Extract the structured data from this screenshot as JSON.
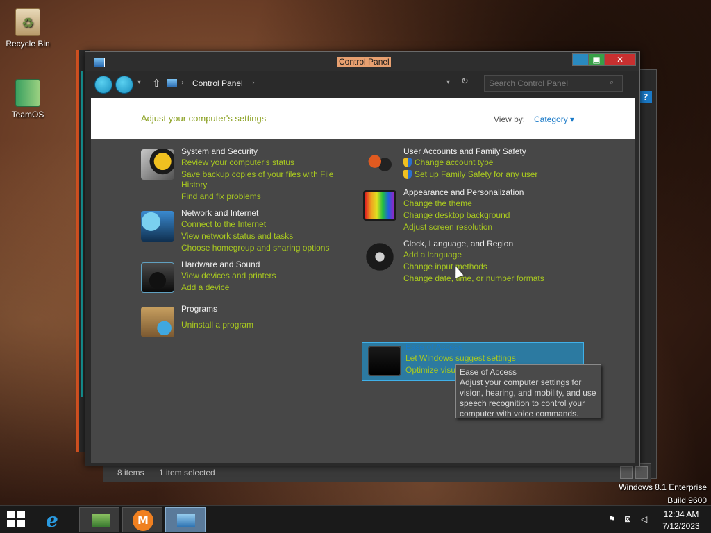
{
  "desktop": {
    "icons": [
      {
        "label": "Recycle Bin"
      },
      {
        "label": "TeamOS"
      }
    ],
    "os_watermark": {
      "line1": "Windows 8.1 Enterprise",
      "line2": "Build 9600"
    }
  },
  "window": {
    "title": "Control Panel",
    "buttons": {
      "minimize": "—",
      "maximize": "▣",
      "close": "✕"
    },
    "breadcrumb": {
      "label": "Control Panel"
    },
    "search": {
      "placeholder": "Search Control Panel"
    },
    "header": {
      "title": "Adjust your computer's settings",
      "view_by_label": "View by:",
      "view_by_value": "Category ▾"
    },
    "categories": [
      {
        "title": "System and Security",
        "icon": "security-shield-icon",
        "links": [
          "Review your computer's status",
          "Save backup copies of your files with File",
          "History",
          "Find and fix problems"
        ]
      },
      {
        "title": "Network and Internet",
        "icon": "network-globe-icon",
        "links": [
          "Connect to the Internet",
          "View network status and tasks",
          "Choose homegroup and sharing options"
        ]
      },
      {
        "title": "Hardware and Sound",
        "icon": "speaker-icon",
        "links": [
          "View devices and printers",
          "Add a device"
        ]
      },
      {
        "title": "Programs",
        "icon": "programs-box-icon",
        "links": [
          "Uninstall a program"
        ]
      },
      {
        "title": "User Accounts and Family Safety",
        "icon": "users-icon",
        "links": [
          "Change account type",
          "Set up Family Safety for any user"
        ]
      },
      {
        "title": "Appearance and Personalization",
        "icon": "monitor-rainbow-icon",
        "links": [
          "Change the theme",
          "Change desktop background",
          "Adjust screen resolution"
        ]
      },
      {
        "title": "Clock, Language, and Region",
        "icon": "clock-globe-icon",
        "links": [
          "Add a language",
          "Change input methods",
          "Change date, time, or number formats"
        ]
      },
      {
        "title": "Ease of Access",
        "icon": "ease-of-access-icon",
        "links": [
          "Let Windows suggest settings",
          "Optimize visual display"
        ]
      }
    ],
    "tooltip": {
      "title": "Ease of Access",
      "lines": [
        "Adjust your computer settings for",
        "vision, hearing, and mobility, and use",
        "speech recognition to control your",
        "computer with voice commands."
      ]
    },
    "status": {
      "item_count": "8 items",
      "selected": "1 item selected"
    }
  },
  "taskbar": {
    "ie_glyph": "e",
    "m_glyph": "M",
    "clock_time": "12:34 AM",
    "clock_date": "7/12/2023"
  }
}
